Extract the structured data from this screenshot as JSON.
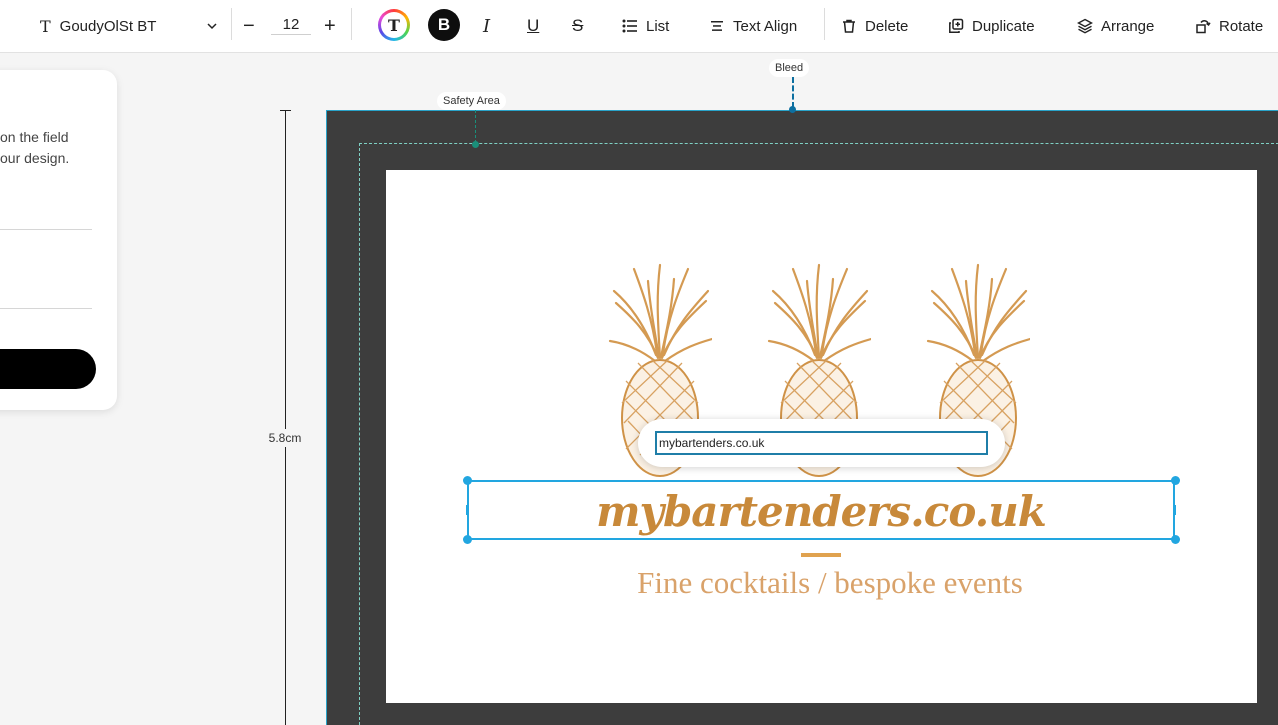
{
  "toolbar": {
    "font_family": "GoudyOlSt BT",
    "font_size": "12",
    "minus": "−",
    "plus": "+",
    "color_letter": "T",
    "bold_letter": "B",
    "italic_letter": "I",
    "underline_letter": "U",
    "strike_letter": "S",
    "list_label": "List",
    "align_label": "Text Align",
    "delete_label": "Delete",
    "duplicate_label": "Duplicate",
    "arrange_label": "Arrange",
    "rotate_label": "Rotate",
    "icons": [
      "text-icon",
      "chevron-down-icon",
      "list-icon",
      "text-align-icon",
      "trash-icon",
      "duplicate-icon",
      "layers-icon",
      "rotate-icon"
    ]
  },
  "panel": {
    "line1": "on the field",
    "line2": "our design."
  },
  "canvas": {
    "safety_label": "Safety Area",
    "bleed_label": "Bleed",
    "height_measure": "5.8cm",
    "edit_value": "mybartenders.co.uk",
    "headline": "mybartenders.co.uk",
    "tagline": "Fine cocktails / bespoke events",
    "colors": {
      "bleed": "#3d3d3d",
      "gold": "#c8893a",
      "selection": "#22a6e0",
      "safety_line": "#1a8f7a"
    }
  }
}
